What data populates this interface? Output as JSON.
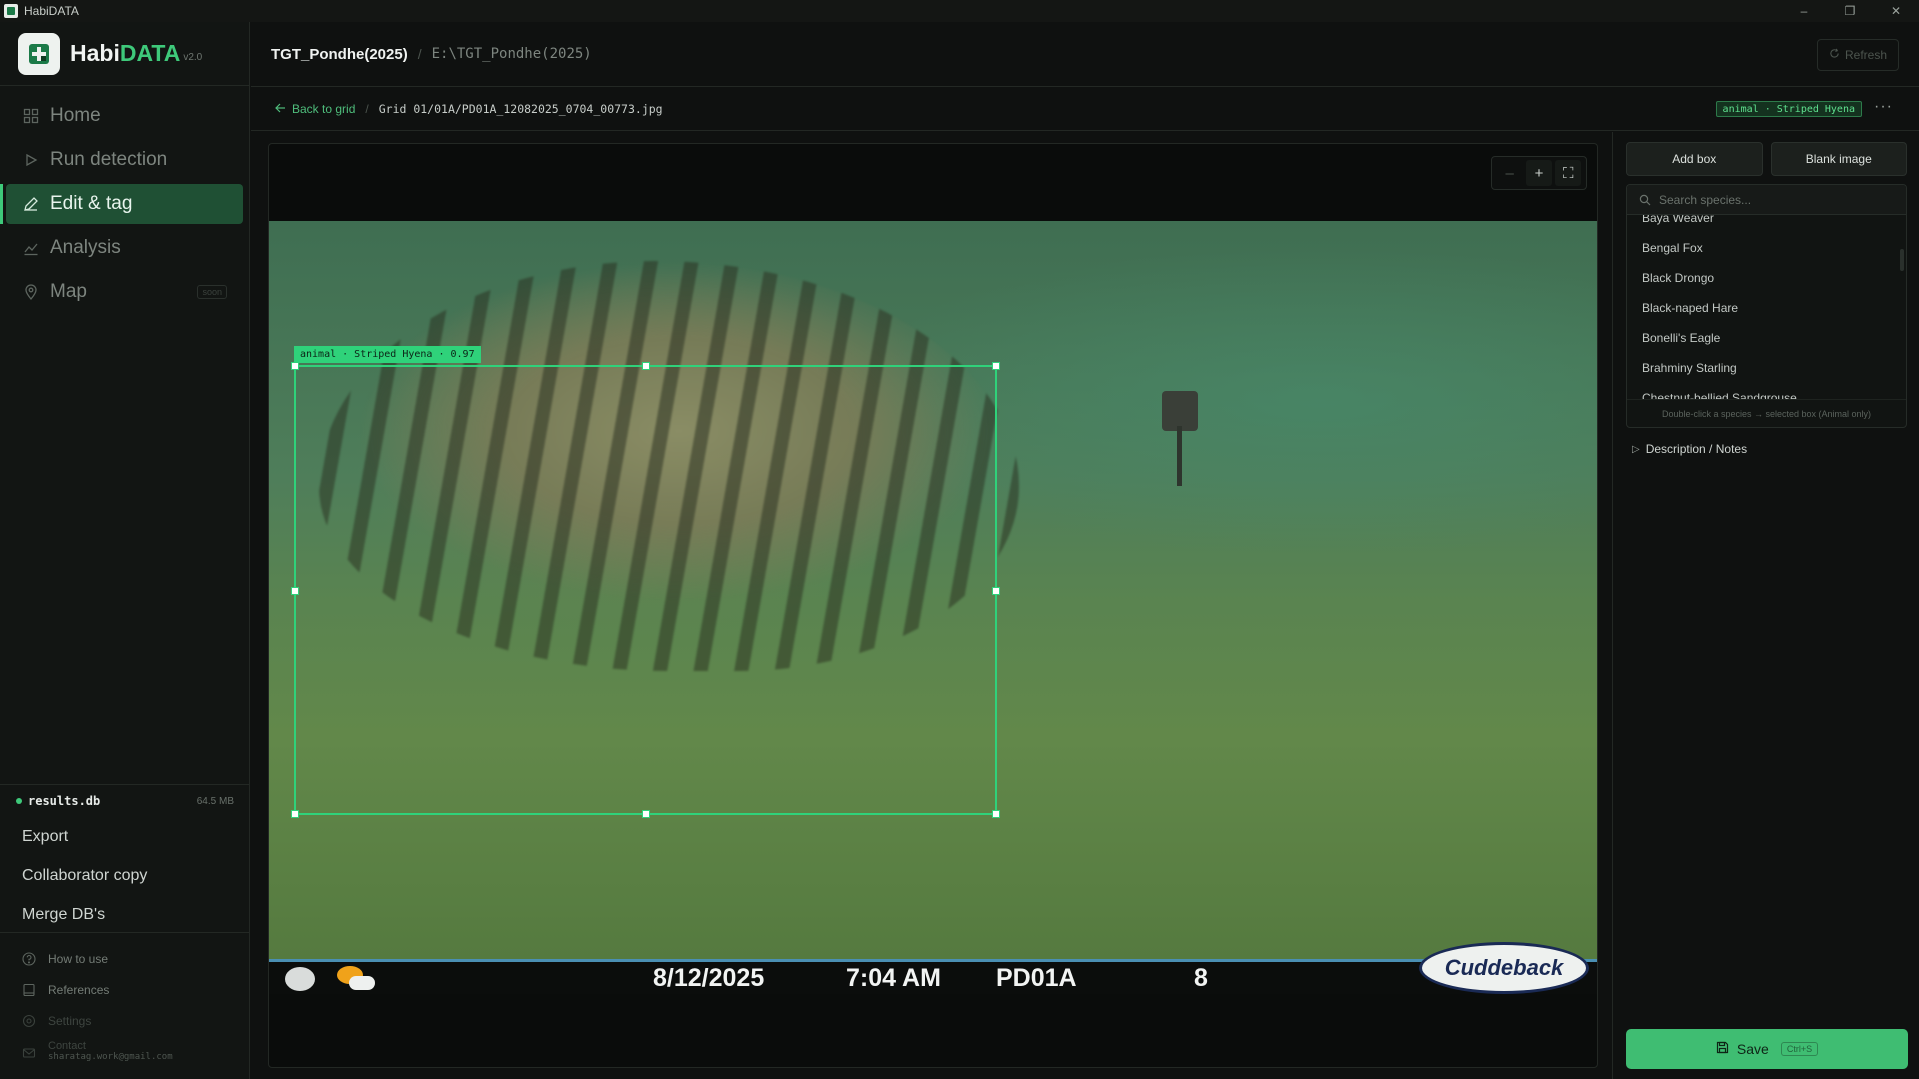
{
  "window": {
    "title": "HabiDATA",
    "controls": [
      "–",
      "❐",
      "✕"
    ]
  },
  "brand": {
    "name_a": "Habi",
    "name_b": "DATA",
    "version": "v2.0"
  },
  "nav": [
    {
      "label": "Home",
      "icon": "grid-icon",
      "active": false
    },
    {
      "label": "Run detection",
      "icon": "play-icon",
      "active": false
    },
    {
      "label": "Edit & tag",
      "icon": "pencil-icon",
      "active": true
    },
    {
      "label": "Analysis",
      "icon": "chart-icon",
      "active": false
    },
    {
      "label": "Map",
      "icon": "map-pin-icon",
      "active": false,
      "badge": "soon"
    }
  ],
  "database": {
    "name": "results.db",
    "size": "64.5 MB"
  },
  "side_actions": [
    "Export",
    "Collaborator copy",
    "Merge DB's"
  ],
  "help": {
    "how_to_use": "How to use",
    "references": "References",
    "settings": "Settings",
    "contact_label": "Contact",
    "contact_email": "sharatag.work@gmail.com"
  },
  "header": {
    "project": "TGT_Pondhe(2025)",
    "separator": "/",
    "path": "E:\\TGT_Pondhe(2025)",
    "refresh": "Refresh"
  },
  "crumb": {
    "back": "Back to grid",
    "separator": "/",
    "file": "Grid 01/01A/PD01A_12082025_0704_00773.jpg",
    "tag": "animal · Striped Hyena",
    "more": "···"
  },
  "zoom": {
    "out": "–",
    "in": "+",
    "fit": "⛶"
  },
  "detection": {
    "label": "animal · Striped Hyena · 0.97"
  },
  "camera_overlay": {
    "date": "8/12/2025",
    "time": "7:04 AM",
    "camera": "PD01A",
    "number": "8",
    "brand": "Cuddeback"
  },
  "panel": {
    "add_box": "Add box",
    "blank_image": "Blank image",
    "search_placeholder": "Search species...",
    "species": [
      "Baya Weaver",
      "Bengal Fox",
      "Black Drongo",
      "Black-naped Hare",
      "Bonelli's Eagle",
      "Brahminy Starling",
      "Chestnut-bellied Sandgrouse"
    ],
    "hint": "Double-click a species → selected box (Animal only)",
    "description": "Description / Notes",
    "save": "Save",
    "save_shortcut": "Ctrl+S"
  },
  "colors": {
    "accent": "#3ec97a",
    "bbox": "#2fd27a",
    "active_nav": "#1f5034"
  }
}
